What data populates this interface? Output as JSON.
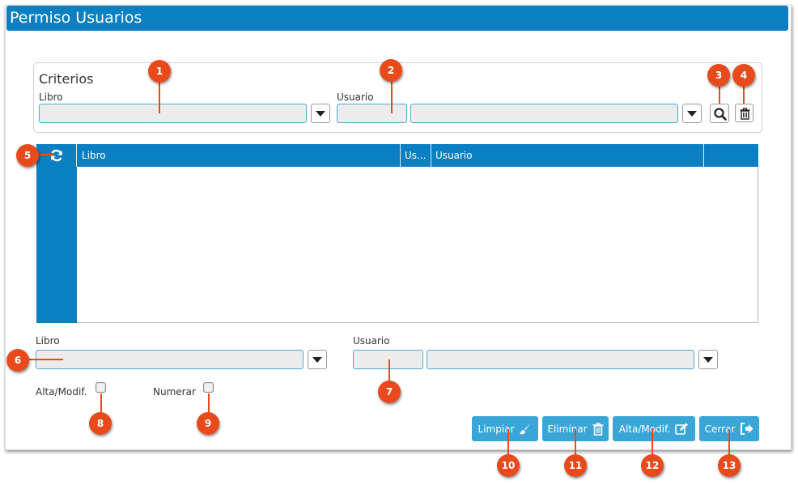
{
  "window": {
    "title": "Permiso Usuarios"
  },
  "criterios": {
    "title": "Criterios",
    "libro_label": "Libro",
    "usuario_label": "Usuario",
    "libro_value": "",
    "usuario_code_value": "",
    "usuario_name_value": ""
  },
  "grid": {
    "columns": [
      "Libro",
      "Us...",
      "Usuario",
      ""
    ],
    "rows": []
  },
  "form": {
    "libro_label": "Libro",
    "usuario_label": "Usuario",
    "libro_value": "",
    "usuario_code_value": "",
    "usuario_name_value": "",
    "alta_modif_label": "Alta/Modif.",
    "numerar_label": "Numerar",
    "alta_modif_checked": false,
    "numerar_checked": false
  },
  "actions": {
    "limpiar": "Limpiar",
    "eliminar": "Eliminar",
    "alta_modif": "Alta/Modif.",
    "cerrar": "Cerrar"
  },
  "icons": {
    "search": "search-icon",
    "trash": "trash-icon",
    "refresh": "refresh-icon",
    "brush": "brush-icon",
    "edit": "edit-icon",
    "exit": "sign-out-icon"
  },
  "callouts": [
    "1",
    "2",
    "3",
    "4",
    "5",
    "6",
    "7",
    "8",
    "9",
    "10",
    "11",
    "12",
    "13"
  ],
  "colors": {
    "header_blue": "#0a7fc1",
    "button_blue": "#3aa6d8",
    "callout_red": "#e84a1c",
    "field_bg": "#ececec"
  }
}
